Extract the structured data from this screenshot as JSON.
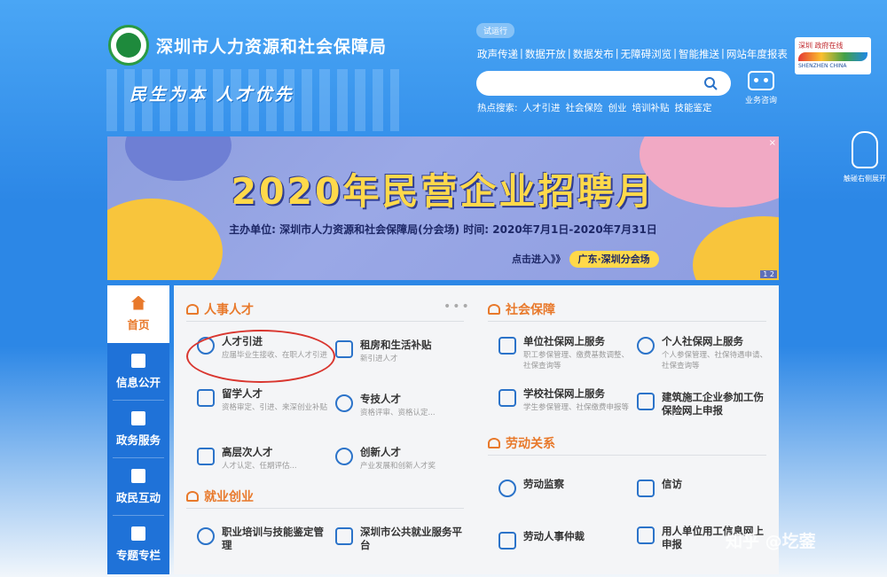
{
  "header": {
    "site_title": "深圳市人力资源和社会保障局",
    "slogan": "民生为本  人才优先",
    "trial_badge": "试运行",
    "nav_links": [
      "政声传递",
      "数据开放",
      "数据发布",
      "无障碍浏览",
      "智能推送",
      "网站年度报表"
    ],
    "search_placeholder": "",
    "hot_label": "热点搜索:",
    "hot_items": [
      "人才引进",
      "社会保险",
      "创业",
      "培训补贴",
      "技能鉴定"
    ],
    "robot_label": "业务咨询",
    "city_logo_text": "深圳 政府在线",
    "city_logo_en": "SHENZHEN CHINA",
    "hand_label": "触碰右侧展开"
  },
  "banner": {
    "title": "2020年民营企业招聘月",
    "subtitle": "主办单位: 深圳市人力资源和社会保障局(分会场)  时间: 2020年7月1日-2020年7月31日",
    "cta": "点击进入》》",
    "cta_pill": "广东·深圳分会场",
    "close": "×",
    "page": "1 2"
  },
  "leftnav": [
    {
      "label": "首页",
      "active": true
    },
    {
      "label": "信息公开",
      "active": false
    },
    {
      "label": "政务服务",
      "active": false
    },
    {
      "label": "政民互动",
      "active": false
    },
    {
      "label": "专题专栏",
      "active": false
    }
  ],
  "sections": {
    "talent": {
      "title": "人事人才",
      "more": "•••",
      "items": [
        {
          "title": "人才引进",
          "desc": "应届毕业生接收、在职人才引进"
        },
        {
          "title": "租房和生活补贴",
          "desc": "新引进人才"
        },
        {
          "title": "留学人才",
          "desc": "资格审定、引进、来深创业补贴"
        },
        {
          "title": "专技人才",
          "desc": "资格评审、资格认定..."
        },
        {
          "title": "高层次人才",
          "desc": "人才认定、任期评估..."
        },
        {
          "title": "创新人才",
          "desc": "产业发展和创新人才奖"
        }
      ]
    },
    "employment": {
      "title": "就业创业",
      "items": [
        {
          "title": "职业培训与技能鉴定管理"
        },
        {
          "title": "深圳市公共就业服务平台"
        }
      ]
    },
    "social": {
      "title": "社会保障",
      "items": [
        {
          "title": "单位社保网上服务",
          "desc": "职工参保管理、缴费基数调整、社保查询等"
        },
        {
          "title": "个人社保网上服务",
          "desc": "个人参保管理、社保待遇申请、社保查询等"
        },
        {
          "title": "学校社保网上服务",
          "desc": "学生参保管理、社保缴费申报等"
        },
        {
          "title": "建筑施工企业参加工伤保险网上申报",
          "desc": ""
        }
      ]
    },
    "labor": {
      "title": "劳动关系",
      "items": [
        {
          "title": "劳动监察"
        },
        {
          "title": "信访"
        },
        {
          "title": "劳动人事仲裁"
        },
        {
          "title": "用人单位用工信息网上申报"
        }
      ]
    }
  },
  "watermark": "知乎 @圪蓥"
}
